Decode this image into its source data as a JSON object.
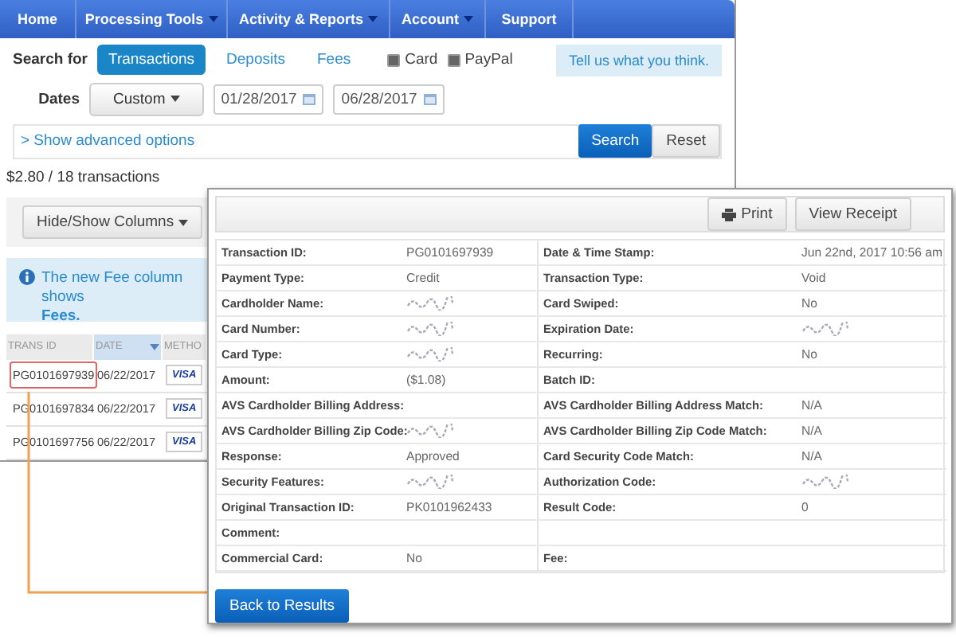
{
  "nav": [
    {
      "label": "Home",
      "has_menu": false
    },
    {
      "label": "Processing Tools",
      "has_menu": true
    },
    {
      "label": "Activity & Reports",
      "has_menu": true
    },
    {
      "label": "Account",
      "has_menu": true
    },
    {
      "label": "Support",
      "has_menu": false
    }
  ],
  "search_for": {
    "label": "Search for",
    "tabs": [
      {
        "label": "Transactions",
        "selected": true
      },
      {
        "label": "Deposits",
        "selected": false
      },
      {
        "label": "Fees",
        "selected": false
      }
    ],
    "filters": [
      {
        "label": "Card",
        "checked": true
      },
      {
        "label": "PayPal",
        "checked": true
      }
    ],
    "feedback_button": "Tell us what you think."
  },
  "dates": {
    "label": "Dates",
    "range": "Custom",
    "from": "01/28/2017",
    "to": "06/28/2017"
  },
  "advanced_link": "> Show advanced options",
  "search_button": "Search",
  "reset_button": "Reset",
  "summary": "$2.80 / 18 transactions",
  "columns_button": "Hide/Show Columns",
  "info_banner": {
    "text": "The new Fee column shows",
    "continued": "Fees."
  },
  "table": {
    "columns": [
      {
        "label": "TRANS ID",
        "sorted": false
      },
      {
        "label": "DATE",
        "sorted": true
      },
      {
        "label": "METHO",
        "sorted": false
      }
    ],
    "rows": [
      {
        "trans_id": "PG0101697939",
        "date": "06/22/2017",
        "card_brand": "VISA",
        "selected": true
      },
      {
        "trans_id": "PG0101697834",
        "date": "06/22/2017",
        "card_brand": "VISA",
        "selected": false
      },
      {
        "trans_id": "PG0101697756",
        "date": "06/22/2017",
        "card_brand": "VISA",
        "selected": false
      }
    ]
  },
  "detail": {
    "print_button": "Print",
    "receipt_button": "View Receipt",
    "back_button": "Back to Results",
    "fields": [
      {
        "label": "Transaction ID:",
        "value": "PG0101697939",
        "kind": "text"
      },
      {
        "label": "Date & Time Stamp:",
        "value": "Jun 22nd, 2017 10:56 am",
        "kind": "text"
      },
      {
        "label": "Payment Type:",
        "value": "Credit",
        "kind": "text"
      },
      {
        "label": "Transaction Type:",
        "value": "Void",
        "kind": "text"
      },
      {
        "label": "Cardholder Name:",
        "kind": "redacted"
      },
      {
        "label": "Card Swiped:",
        "value": "No",
        "kind": "text"
      },
      {
        "label": "Card Number:",
        "kind": "redacted"
      },
      {
        "label": "Expiration Date:",
        "kind": "redacted"
      },
      {
        "label": "Card Type:",
        "kind": "redacted"
      },
      {
        "label": "Recurring:",
        "value": "No",
        "kind": "text"
      },
      {
        "label": "Amount:",
        "value": "($1.08)",
        "kind": "text"
      },
      {
        "label": "Batch ID:",
        "kind": "none"
      },
      {
        "label": "AVS Cardholder Billing Address:",
        "kind": "none"
      },
      {
        "label": "AVS Cardholder Billing Address Match:",
        "value": "N/A",
        "kind": "text"
      },
      {
        "label": "AVS Cardholder Billing Zip Code:",
        "kind": "redacted"
      },
      {
        "label": "AVS Cardholder Billing Zip Code Match:",
        "value": "N/A",
        "kind": "text"
      },
      {
        "label": "Response:",
        "value": "Approved",
        "kind": "text"
      },
      {
        "label": "Card Security Code Match:",
        "value": "N/A",
        "kind": "text"
      },
      {
        "label": "Security Features:",
        "kind": "redacted"
      },
      {
        "label": "Authorization Code:",
        "kind": "redacted"
      },
      {
        "label": "Original Transaction ID:",
        "value": "PK0101962433",
        "kind": "text"
      },
      {
        "label": "Result Code:",
        "value": "0",
        "kind": "text"
      },
      {
        "label": "Comment:",
        "kind": "none"
      },
      {
        "kind": "blank"
      },
      {
        "label": "Commercial Card:",
        "value": "No",
        "kind": "text"
      },
      {
        "label": "Fee:",
        "kind": "none"
      }
    ]
  }
}
